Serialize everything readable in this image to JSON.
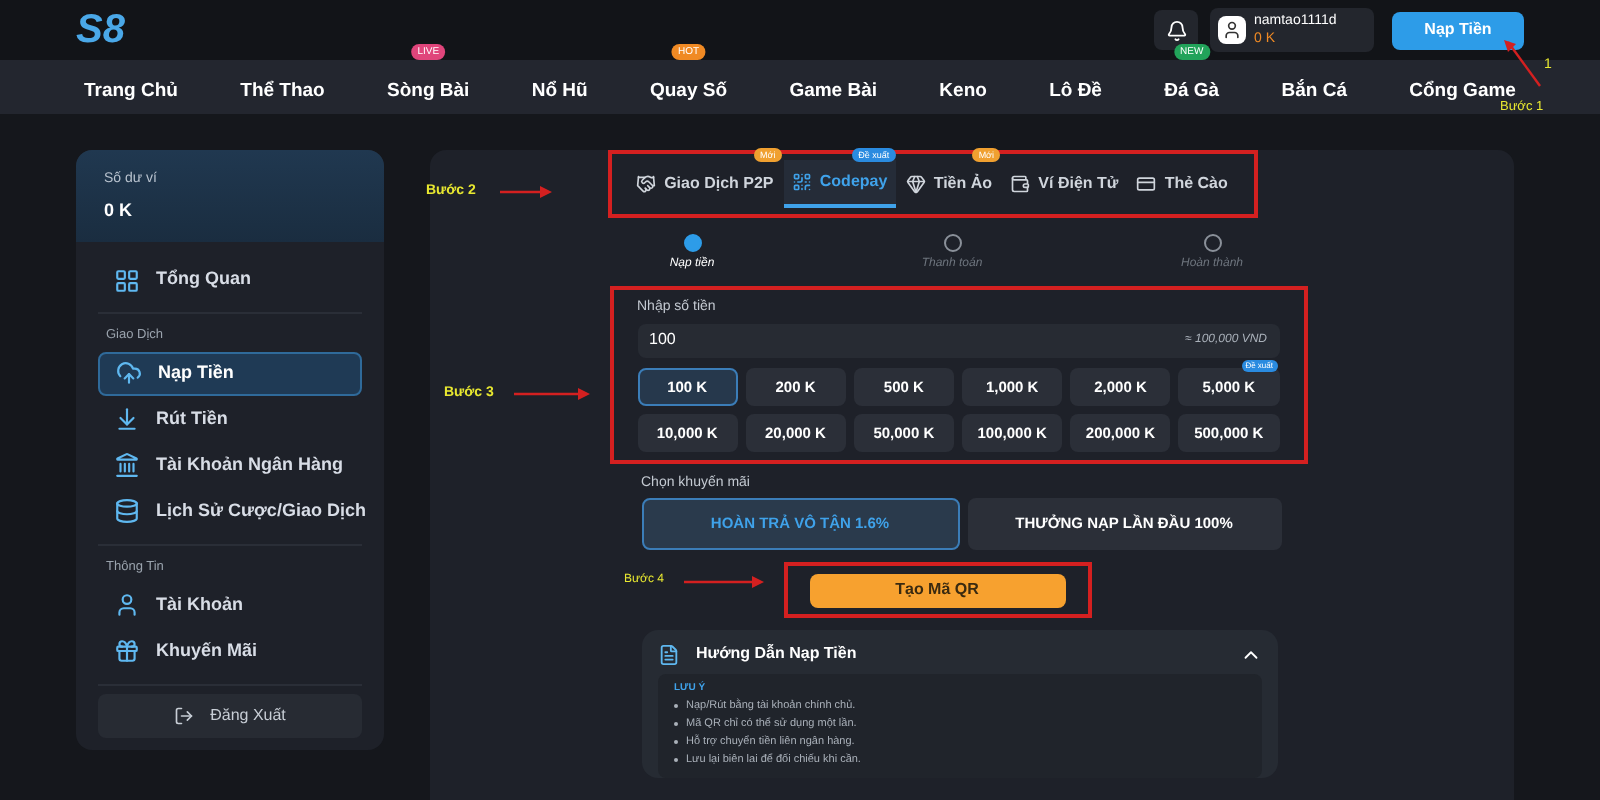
{
  "header": {
    "logo": "S8",
    "username": "namtao1111d",
    "balance": "0 K",
    "deposit_button": "Nạp Tiền"
  },
  "nav": [
    {
      "label": "Trang Chủ"
    },
    {
      "label": "Thể Thao"
    },
    {
      "label": "Sòng Bài",
      "badge": "LIVE",
      "color": "#e0457b"
    },
    {
      "label": "Nổ Hũ"
    },
    {
      "label": "Quay Số",
      "badge": "HOT",
      "color": "#f08a24"
    },
    {
      "label": "Game Bài"
    },
    {
      "label": "Keno"
    },
    {
      "label": "Lô Đề"
    },
    {
      "label": "Đá Gà",
      "badge": "NEW",
      "color": "#22a35a"
    },
    {
      "label": "Bắn Cá"
    },
    {
      "label": "Cổng Game"
    }
  ],
  "sidebar": {
    "wallet_label": "Số dư ví",
    "wallet_value": "0 K",
    "overview": {
      "label": "Tổng Quan",
      "kind": "grid",
      "selected": false
    },
    "sections": [
      {
        "title": "Giao Dịch",
        "items": [
          {
            "label": "Nạp Tiền",
            "kind": "deposit",
            "selected": true
          },
          {
            "label": "Rút Tiền",
            "kind": "withdraw",
            "selected": false
          },
          {
            "label": "Tài Khoản Ngân Hàng",
            "kind": "bank",
            "selected": false
          },
          {
            "label": "Lịch Sử Cược/Giao Dịch",
            "kind": "history",
            "selected": false
          }
        ]
      },
      {
        "title": "Thông Tin",
        "items": [
          {
            "label": "Tài Khoản",
            "kind": "user",
            "selected": false
          },
          {
            "label": "Khuyến Mãi",
            "kind": "gift",
            "selected": false
          }
        ]
      }
    ],
    "logout": "Đăng Xuất"
  },
  "tabs": [
    {
      "label": "Giao Dịch P2P",
      "kind": "p2p",
      "badge": "Mới",
      "color": "#f0a030",
      "selected": false
    },
    {
      "label": "Codepay",
      "kind": "qr",
      "badge": "Đề xuất",
      "color": "#2a8be0",
      "selected": true
    },
    {
      "label": "Tiền Ảo",
      "kind": "gem",
      "badge": "Mới",
      "color": "#f0a030",
      "selected": false
    },
    {
      "label": "Ví Điện Tử",
      "kind": "wallet",
      "selected": false
    },
    {
      "label": "Thẻ Cào",
      "kind": "card",
      "selected": false
    }
  ],
  "steps": [
    {
      "label": "Nạp tiền",
      "active": true
    },
    {
      "label": "Thanh toán",
      "active": false
    },
    {
      "label": "Hoàn thành",
      "active": false
    }
  ],
  "amount": {
    "label": "Nhập số tiền",
    "value": "100",
    "conversion": "≈ 100,000 VND"
  },
  "presets": [
    {
      "label": "100 K",
      "selected": true
    },
    {
      "label": "200 K",
      "selected": false
    },
    {
      "label": "500 K",
      "selected": false
    },
    {
      "label": "1,000 K",
      "selected": false
    },
    {
      "label": "2,000 K",
      "selected": false
    },
    {
      "label": "5,000 K",
      "selected": false,
      "badge": "Đề xuất"
    },
    {
      "label": "10,000 K",
      "selected": false
    },
    {
      "label": "20,000 K",
      "selected": false
    },
    {
      "label": "50,000 K",
      "selected": false
    },
    {
      "label": "100,000 K",
      "selected": false
    },
    {
      "label": "200,000 K",
      "selected": false
    },
    {
      "label": "500,000 K",
      "selected": false
    }
  ],
  "promo": {
    "label": "Chọn khuyến mãi",
    "options": [
      {
        "label": "HOÀN TRẢ VÔ TẬN 1.6%",
        "selected": true
      },
      {
        "label": "THƯỞNG NẠP LẦN ĐẦU 100%",
        "selected": false
      }
    ]
  },
  "qr_button": "Tạo Mã QR",
  "guide": {
    "title": "Hướng Dẫn Nạp Tiền",
    "expanded": true,
    "note_title": "LƯU Ý",
    "notes": [
      "Nạp/Rút bằng tài khoản chính chủ.",
      "Mã QR chỉ có thể sử dụng một lần.",
      "Hỗ trợ chuyển tiền liên ngân hàng.",
      "Lưu lại biên lai để đối chiếu khi cần."
    ]
  },
  "annotations": {
    "step1": "Bước 1",
    "step1_number": "1",
    "step2": "Bước 2",
    "step3": "Bước 3",
    "step4": "Bước 4"
  }
}
